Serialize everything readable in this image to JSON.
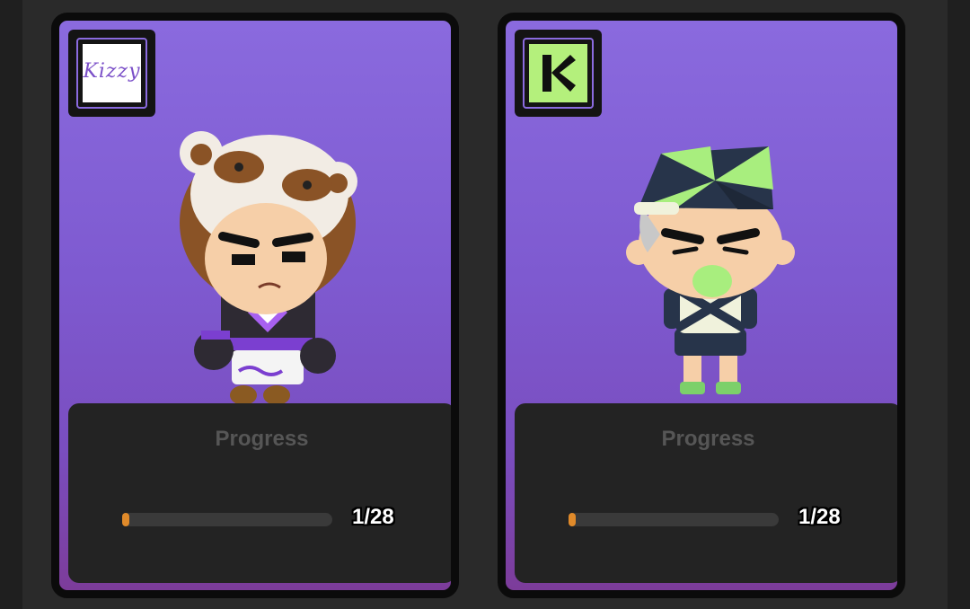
{
  "cards": [
    {
      "brand": {
        "icon": "kizzy-logo",
        "text": "Kizzy",
        "tile_color": "#ffffff"
      },
      "character": "panda-hood-character-icon",
      "progress": {
        "title": "Progress",
        "label": "1/28",
        "value": 1,
        "total": 28
      }
    },
    {
      "brand": {
        "icon": "k-logo-icon",
        "tile_color": "#b4f07c"
      },
      "character": "green-cap-character-icon",
      "progress": {
        "title": "Progress",
        "label": "1/28",
        "value": 1,
        "total": 28
      }
    }
  ],
  "colors": {
    "card_gradient_top": "#8a6ade",
    "card_gradient_bottom": "#7c3c9a",
    "progress_fill": "#e08a2a",
    "brand_border": "#8b6be0"
  }
}
